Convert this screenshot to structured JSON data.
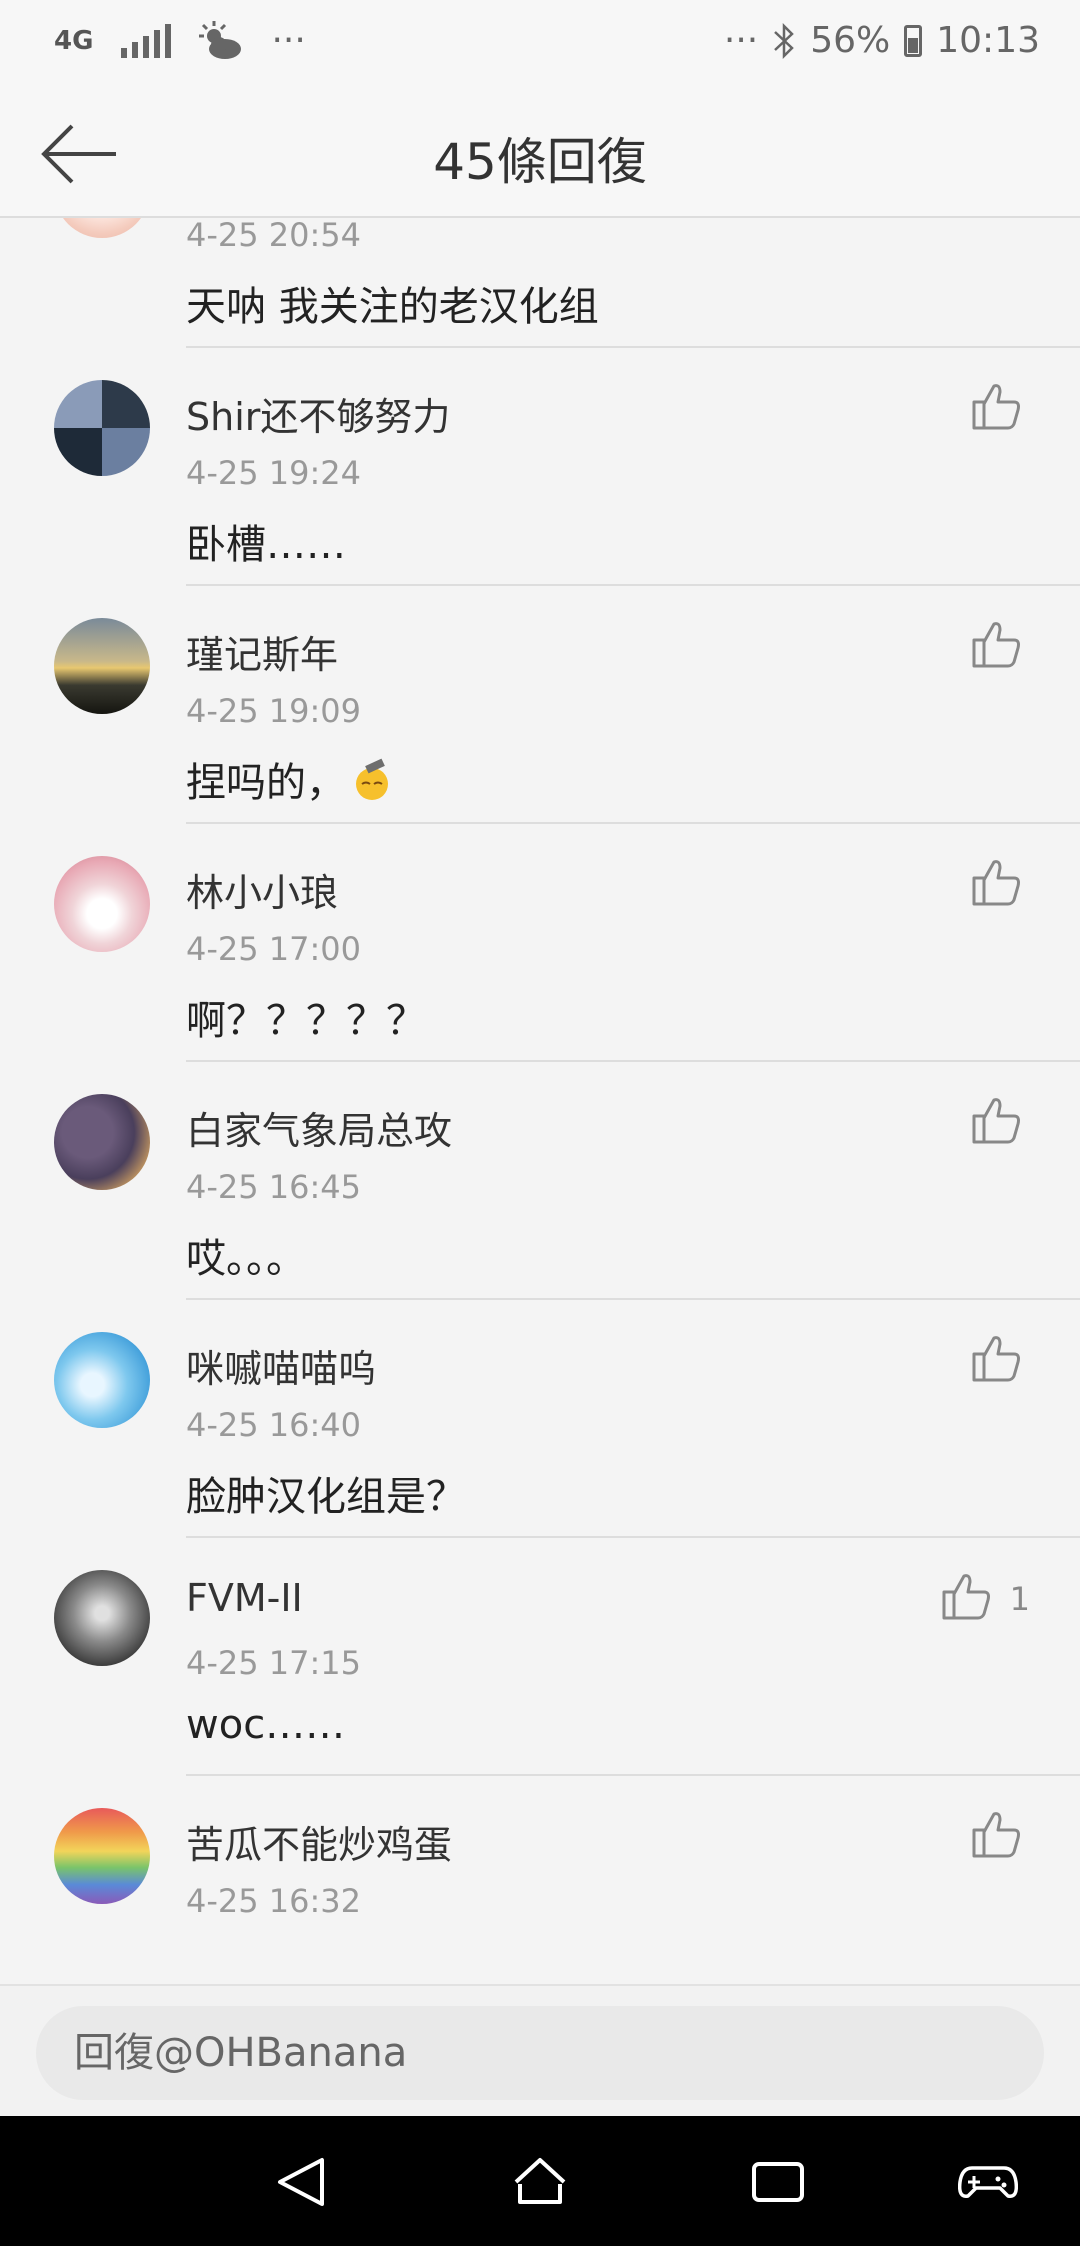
{
  "status_bar": {
    "network": "4G",
    "more": "···",
    "more_right": "···",
    "battery": "56%",
    "time": "10:13"
  },
  "header": {
    "title": "45條回復"
  },
  "comments": [
    {
      "name": "",
      "time": "4-25 20:54",
      "content": "天呐 我关注的老汉化组",
      "likes": ""
    },
    {
      "name": "Shir还不够努力",
      "time": "4-25 19:24",
      "content": "卧槽……",
      "likes": ""
    },
    {
      "name": "瑾记斯年",
      "time": "4-25 19:09",
      "content": "捏吗的，",
      "likes": ""
    },
    {
      "name": "林小小琅",
      "time": "4-25 17:00",
      "content": "啊？？？？？",
      "likes": ""
    },
    {
      "name": "白家气象局总攻",
      "time": "4-25 16:45",
      "content": "哎。。。",
      "likes": ""
    },
    {
      "name": "咪嘁喵喵呜",
      "time": "4-25 16:40",
      "content": "脸肿汉化组是？",
      "likes": ""
    },
    {
      "name": "FVM-II",
      "time": "4-25 17:15",
      "content": "woc……",
      "likes": "1"
    },
    {
      "name": "苦瓜不能炒鸡蛋",
      "time": "4-25 16:32",
      "content": "",
      "likes": ""
    }
  ],
  "reply": {
    "placeholder": "回復@OHBanana"
  },
  "colors": {
    "background": "#f4f4f4",
    "divider": "#dddddd",
    "text": "#333333",
    "secondary": "#999999",
    "navbar": "#000000"
  }
}
